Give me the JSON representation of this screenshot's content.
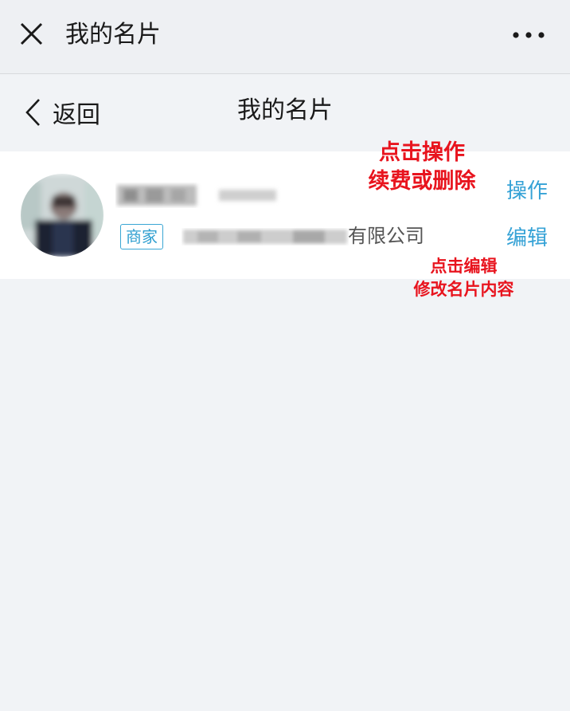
{
  "header": {
    "title": "我的名片",
    "close_icon": "close-icon",
    "more_icon": "more-dots-icon"
  },
  "nav": {
    "back_label": "返回",
    "title": "我的名片"
  },
  "card": {
    "tag": "商家",
    "company_suffix": "有限公司",
    "actions": {
      "operate": "操作",
      "edit": "编辑"
    }
  },
  "annotations": {
    "operate_line1": "点击操作",
    "operate_line2": "续费或删除",
    "edit_line1": "点击编辑",
    "edit_line2": "修改名片内容"
  },
  "colors": {
    "link": "#35a2d6",
    "annotation": "#e8141e",
    "background": "#f1f3f6"
  }
}
